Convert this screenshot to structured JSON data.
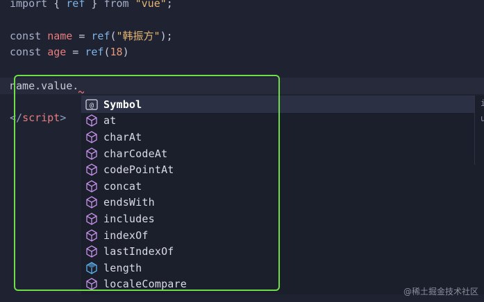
{
  "editor": {
    "lines": {
      "import": {
        "kw1": "import",
        "brace_open": " { ",
        "ref": "ref",
        "brace_close": " } ",
        "from": "from",
        "module": "\"vue\"",
        "semi": ";"
      },
      "name_decl": {
        "kw": "const",
        "var": "name",
        "eq": " = ",
        "fn": "ref",
        "open": "(",
        "str": "\"韩振方\"",
        "close": ");"
      },
      "age_decl": {
        "kw": "const",
        "var": "age",
        "eq": " = ",
        "fn": "ref",
        "open": "(",
        "num": "18",
        "close": ")"
      },
      "current": {
        "text": "name.value."
      },
      "script_close": {
        "open": "</",
        "tag": "script",
        "close": ">"
      }
    }
  },
  "suggest": {
    "items": [
      {
        "label": "Symbol",
        "icon": "symbol-key-icon",
        "selected": true
      },
      {
        "label": "at",
        "icon": "method-cube-icon"
      },
      {
        "label": "charAt",
        "icon": "method-cube-icon"
      },
      {
        "label": "charCodeAt",
        "icon": "method-cube-icon"
      },
      {
        "label": "codePointAt",
        "icon": "method-cube-icon"
      },
      {
        "label": "concat",
        "icon": "method-cube-icon"
      },
      {
        "label": "endsWith",
        "icon": "method-cube-icon"
      },
      {
        "label": "includes",
        "icon": "method-cube-icon"
      },
      {
        "label": "indexOf",
        "icon": "method-cube-icon"
      },
      {
        "label": "lastIndexOf",
        "icon": "method-cube-icon"
      },
      {
        "label": "length",
        "icon": "field-cube-icon"
      },
      {
        "label": "localeCompare",
        "icon": "method-cube-icon"
      }
    ],
    "detail": {
      "line1": "i",
      "line2": "u"
    }
  },
  "colors": {
    "highlight_box": "#6fe04a",
    "method_icon": "#c792ea",
    "field_icon": "#5fb3f0"
  },
  "watermark": "@稀土掘金技术社区"
}
